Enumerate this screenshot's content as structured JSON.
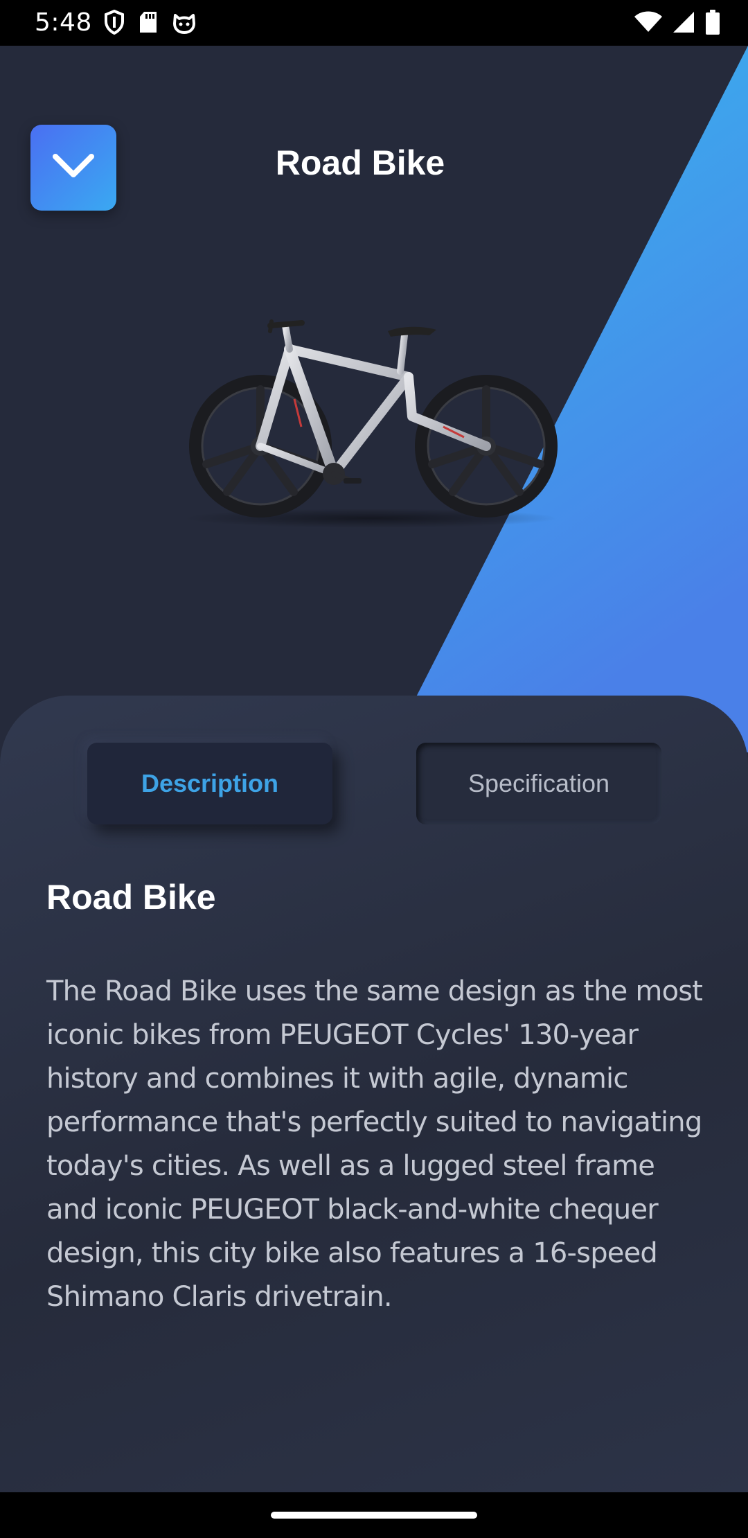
{
  "status_bar": {
    "time": "5:48",
    "left_icons": [
      "shield-icon",
      "sd-card-icon",
      "cat-icon"
    ],
    "right_icons": [
      "wifi-icon",
      "cellular-signal-icon",
      "battery-icon"
    ]
  },
  "header": {
    "title": "Road Bike",
    "menu_icon": "chevron-down-icon"
  },
  "hero": {
    "image": "road-bike-image",
    "accent_gradient": [
      "#38b6ee",
      "#4a7fe8"
    ],
    "background": "#252a3b"
  },
  "tabs": [
    {
      "label": "Description",
      "active": true
    },
    {
      "label": "Specification",
      "active": false
    }
  ],
  "content": {
    "title": "Road Bike",
    "description": "The Road Bike uses the same design as the most iconic bikes from PEUGEOT Cycles' 130-year history and combines it with agile, dynamic performance that's perfectly suited to navigating today's cities. As well as a lugged steel frame and iconic PEUGEOT black-and-white chequer design, this city bike also features a 16-speed Shimano Claris drivetrain."
  },
  "colors": {
    "accent": "#3ea3e6",
    "background": "#252a3a",
    "text": "#ffffff"
  }
}
